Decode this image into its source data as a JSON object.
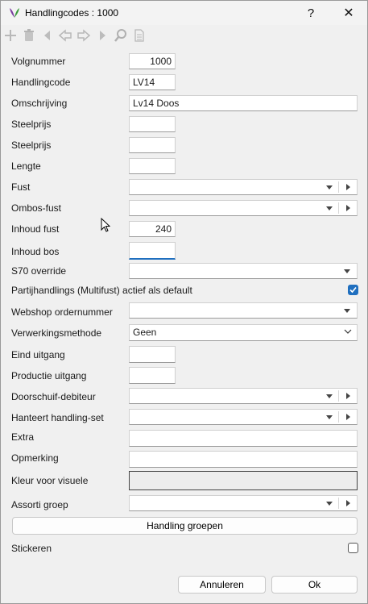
{
  "window": {
    "title": "Handlingcodes : 1000",
    "help_label": "?",
    "close_label": "✕"
  },
  "toolbar": {
    "icons": [
      "add-icon",
      "delete-icon",
      "first-icon",
      "previous-icon",
      "next-icon",
      "last-icon",
      "search-icon",
      "document-icon"
    ]
  },
  "form": {
    "volgnummer": {
      "label": "Volgnummer",
      "value": "1000"
    },
    "handlingcode": {
      "label": "Handlingcode",
      "value": "LV14"
    },
    "omschrijving": {
      "label": "Omschrijving",
      "value": "Lv14 Doos"
    },
    "steelprijs1": {
      "label": "Steelprijs",
      "value": ""
    },
    "steelprijs2": {
      "label": "Steelprijs",
      "value": ""
    },
    "lengte": {
      "label": "Lengte",
      "value": ""
    },
    "fust": {
      "label": "Fust",
      "value": ""
    },
    "ombos_fust": {
      "label": "Ombos-fust",
      "value": ""
    },
    "inhoud_fust": {
      "label": "Inhoud fust",
      "value": "240"
    },
    "inhoud_bos": {
      "label": "Inhoud bos",
      "value": ""
    },
    "s70_override": {
      "label": "S70 override",
      "value": ""
    },
    "partijhandlings": {
      "label": "Partijhandlings (Multifust) actief als default",
      "checked": true
    },
    "webshop_ordernummer": {
      "label": "Webshop ordernummer",
      "value": ""
    },
    "verwerkingsmethode": {
      "label": "Verwerkingsmethode",
      "value": "Geen"
    },
    "eind_uitgang": {
      "label": "Eind uitgang",
      "value": ""
    },
    "productie_uitgang": {
      "label": "Productie uitgang",
      "value": ""
    },
    "doorschuif_debiteur": {
      "label": "Doorschuif-debiteur",
      "value": ""
    },
    "hanteert_handling_set": {
      "label": "Hanteert handling-set",
      "value": ""
    },
    "extra": {
      "label": "Extra",
      "value": ""
    },
    "opmerking": {
      "label": "Opmerking",
      "value": ""
    },
    "kleur_voor_visuele": {
      "label": "Kleur voor visuele",
      "value": ""
    },
    "assorti_groep": {
      "label": "Assorti groep",
      "value": ""
    },
    "handling_groepen_label": "Handling groepen",
    "stickeren": {
      "label": "Stickeren",
      "checked": false
    }
  },
  "footer": {
    "cancel_label": "Annuleren",
    "ok_label": "Ok"
  },
  "colors": {
    "accent": "#1f6fbf",
    "window_bg": "#f0f0f0",
    "logo_purple": "#7b3fa0",
    "logo_green": "#3c9a3c"
  }
}
